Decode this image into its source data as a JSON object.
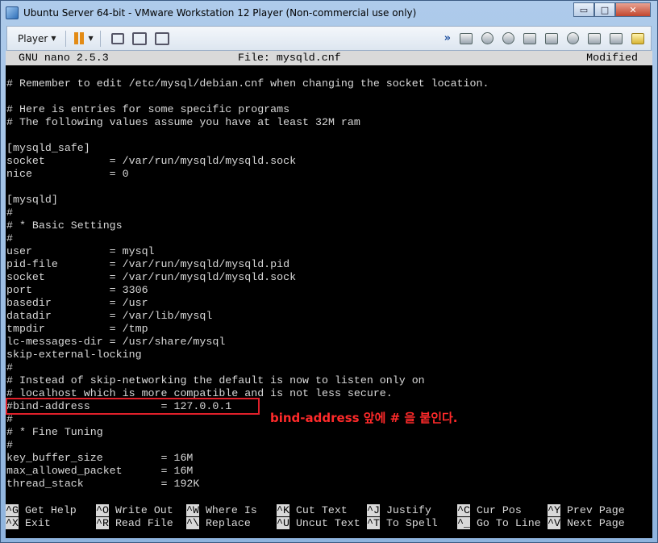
{
  "window": {
    "title": "Ubuntu Server 64-bit - VMware Workstation 12 Player (Non-commercial use only)",
    "controls": {
      "minimize": "▭",
      "maximize": "□",
      "close": "✕"
    }
  },
  "toolbar": {
    "player_label": "Player",
    "icons": [
      "pause-icon",
      "send-ctrl-alt-del-icon",
      "fullscreen-icon",
      "unity-icon"
    ],
    "right_icons": [
      "chevron-icon",
      "hard-disk-icon",
      "cd-dvd-icon",
      "network-icon",
      "usb-icon",
      "printer-icon",
      "sound-icon",
      "display-icon",
      "floppy-icon",
      "message-icon"
    ]
  },
  "nano": {
    "version": "GNU nano 2.5.3",
    "file": "File: mysqld.cnf",
    "status": "Modified",
    "lines": [
      "# Remember to edit /etc/mysql/debian.cnf when changing the socket location.",
      "",
      "# Here is entries for some specific programs",
      "# The following values assume you have at least 32M ram",
      "",
      "[mysqld_safe]",
      "socket          = /var/run/mysqld/mysqld.sock",
      "nice            = 0",
      "",
      "[mysqld]",
      "#",
      "# * Basic Settings",
      "#",
      "user            = mysql",
      "pid-file        = /var/run/mysqld/mysqld.pid",
      "socket          = /var/run/mysqld/mysqld.sock",
      "port            = 3306",
      "basedir         = /usr",
      "datadir         = /var/lib/mysql",
      "tmpdir          = /tmp",
      "lc-messages-dir = /usr/share/mysql",
      "skip-external-locking",
      "#",
      "# Instead of skip-networking the default is now to listen only on",
      "# localhost which is more compatible and is not less secure.",
      "#bind-address           = 127.0.0.1",
      "#",
      "# * Fine Tuning",
      "#",
      "key_buffer_size         = 16M",
      "max_allowed_packet      = 16M",
      "thread_stack            = 192K"
    ],
    "annotation": "bind-address 앞에 # 을 붙인다.",
    "shortcuts": [
      {
        "key": "^G",
        "label": " Get Help"
      },
      {
        "key": "^O",
        "label": " Write Out"
      },
      {
        "key": "^W",
        "label": " Where Is"
      },
      {
        "key": "^K",
        "label": " Cut Text"
      },
      {
        "key": "^J",
        "label": " Justify"
      },
      {
        "key": "^C",
        "label": " Cur Pos"
      },
      {
        "key": "^Y",
        "label": " Prev Page"
      },
      {
        "key": "^X",
        "label": " Exit"
      },
      {
        "key": "^R",
        "label": " Read File"
      },
      {
        "key": "^\\",
        "label": " Replace"
      },
      {
        "key": "^U",
        "label": " Uncut Text"
      },
      {
        "key": "^T",
        "label": " To Spell"
      },
      {
        "key": "^_",
        "label": " Go To Line"
      },
      {
        "key": "^V",
        "label": " Next Page"
      }
    ]
  },
  "colors": {
    "accent_pause": "#e38b15",
    "annotation": "#ff2a2a",
    "terminal_bg": "#000000",
    "terminal_fg": "#d8d8d8"
  }
}
